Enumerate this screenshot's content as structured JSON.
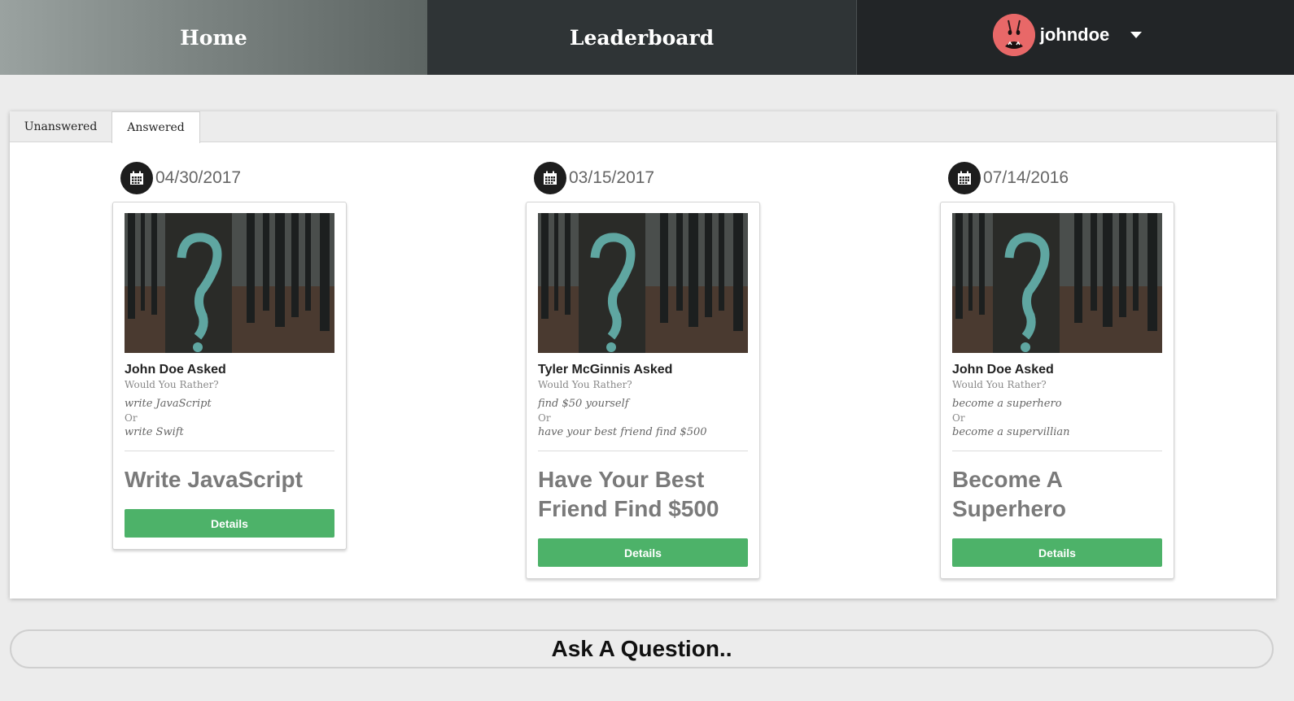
{
  "nav": {
    "home_label": "Home",
    "leaderboard_label": "Leaderboard",
    "username": "johndoe"
  },
  "tabs": {
    "unanswered": "Unanswered",
    "answered": "Answered",
    "active": "Answered"
  },
  "cards": [
    {
      "date": "04/30/2017",
      "asker": "John Doe Asked",
      "prompt": "Would You Rather?",
      "option_one": "write JavaScript",
      "or": "Or",
      "option_two": "write Swift",
      "answer": "Write JavaScript",
      "button": "Details"
    },
    {
      "date": "03/15/2017",
      "asker": "Tyler McGinnis Asked",
      "prompt": "Would You Rather?",
      "option_one": "find $50 yourself",
      "or": "Or",
      "option_two": "have your best friend find $500",
      "answer": "Have Your Best Friend Find $500",
      "button": "Details"
    },
    {
      "date": "07/14/2016",
      "asker": "John Doe Asked",
      "prompt": "Would You Rather?",
      "option_one": "become a superhero",
      "or": "Or",
      "option_two": "become a supervillian",
      "answer": "Become A Superhero",
      "button": "Details"
    }
  ],
  "ask_label": "Ask A Question..",
  "colors": {
    "details_button": "#4db269",
    "avatar": "#e86868",
    "nav_dark": "#222527"
  },
  "icons": {
    "calendar": "calendar-icon",
    "avatar": "avatar-face-icon",
    "dropdown": "caret-down-icon"
  }
}
